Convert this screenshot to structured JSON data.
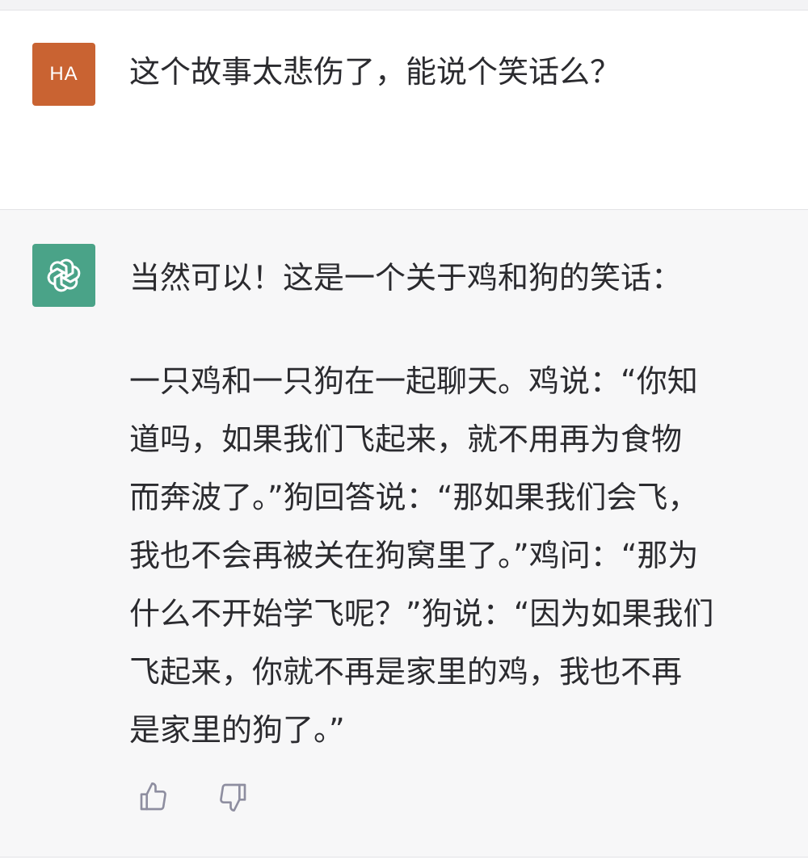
{
  "user_message": {
    "avatar_initials": "HA",
    "avatar_color": "#c96332",
    "text": "这个故事太悲伤了，能说个笑话么？"
  },
  "assistant_message": {
    "avatar_icon": "openai-logo-icon",
    "avatar_color": "#4aa388",
    "intro": "当然可以！这是一个关于鸡和狗的笑话：",
    "body_lines": [
      "一只鸡和一只狗在一起聊天。鸡说：“你知",
      "道吗，如果我们飞起来，就不用再为食物",
      "而奔波了。”狗回答说：“那如果我们会飞，",
      "我也不会再被关在狗窝里了。”鸡问：“那为",
      "什么不开始学飞呢？”狗说：“因为如果我们",
      "飞起来，你就不再是家里的鸡，我也不再",
      "是家里的狗了。”"
    ]
  },
  "feedback": {
    "thumbs_up_icon": "thumbs-up-icon",
    "thumbs_down_icon": "thumbs-down-icon"
  }
}
